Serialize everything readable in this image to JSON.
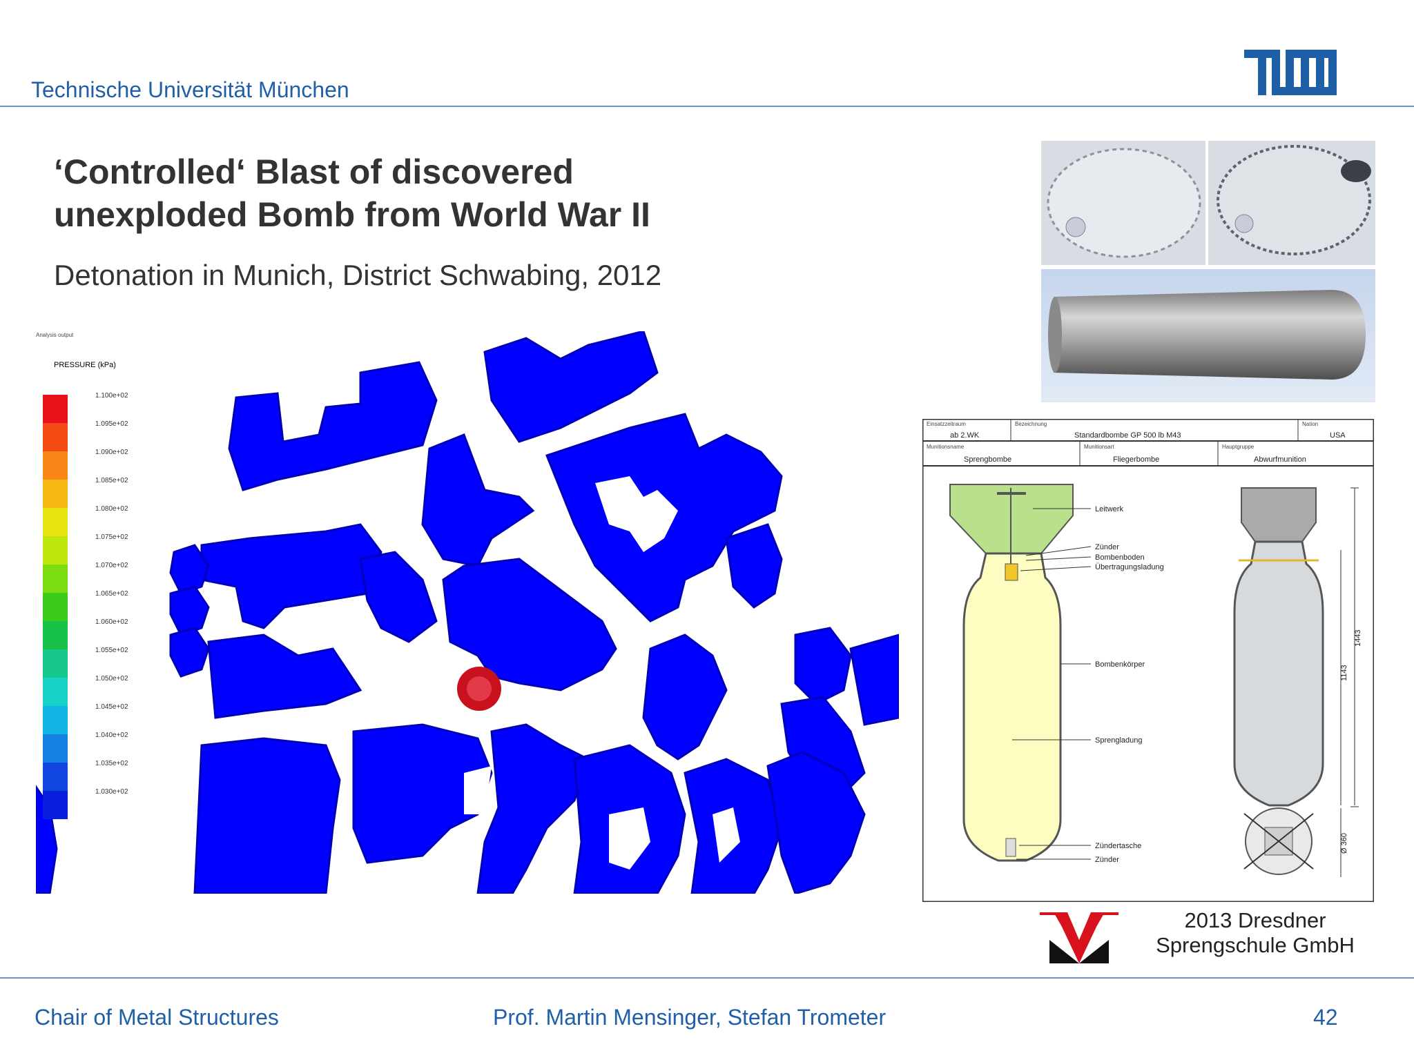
{
  "header": {
    "institution": "Technische Universität München"
  },
  "logos": {
    "tum": "TUM logo",
    "school": "Dresdner Sprengschule logo"
  },
  "slide": {
    "title_line1": "‘Controlled‘ Blast of discovered",
    "title_line2": "unexploded Bomb from World War II",
    "subtitle": "Detonation in Munich, District Schwabing, 2012"
  },
  "simulation": {
    "legend_title": "PRESSURE (kPa)",
    "legend_values": [
      "1.100e+02",
      "1.095e+02",
      "1.090e+02",
      "1.085e+02",
      "1.080e+02",
      "1.075e+02",
      "1.070e+02",
      "1.065e+02",
      "1.060e+02",
      "1.055e+02",
      "1.050e+02",
      "1.045e+02",
      "1.040e+02",
      "1.035e+02",
      "1.030e+02"
    ],
    "legend_colors": [
      "#e8121a",
      "#f24a12",
      "#f8861a",
      "#f6b812",
      "#e8e410",
      "#bce60e",
      "#7cdc12",
      "#3acb1a",
      "#18c24a",
      "#16c88e",
      "#18d2ca",
      "#12b6e6",
      "#1480e2",
      "#1046e0",
      "#0a1ee0"
    ],
    "building_color": "#0000ff",
    "charge_color": "#c8101e"
  },
  "drawing": {
    "row1": {
      "c1_label": "Einsatzzeitraum",
      "c1_value": "ab 2.WK",
      "c2_label": "Bezeichnung",
      "c2_value": "Standardbombe GP 500 lb  M43",
      "c3_label": "Nation",
      "c3_value": "USA"
    },
    "row2": {
      "c1_label": "Munitionsname",
      "c1_value": "Sprengbombe",
      "c2_label": "Munitionsart",
      "c2_value": "Fliegerbombe",
      "c3_label": "Hauptgruppe",
      "c3_value": "Abwurfmunition"
    },
    "parts": [
      "Leitwerk",
      "Zünder",
      "Bombenboden",
      "Übertragungsladung",
      "Bombenkörper",
      "Sprengladung",
      "Zündertasche",
      "Zünder"
    ],
    "dims": [
      "1443",
      "1143",
      "Ø 360"
    ]
  },
  "credit": {
    "line1": "2013   Dresdner",
    "line2": "Sprengschule GmbH"
  },
  "footer": {
    "left": "Chair  of Metal Structures",
    "center": "Prof. Martin Mensinger, Stefan Trometer",
    "page": "42"
  }
}
